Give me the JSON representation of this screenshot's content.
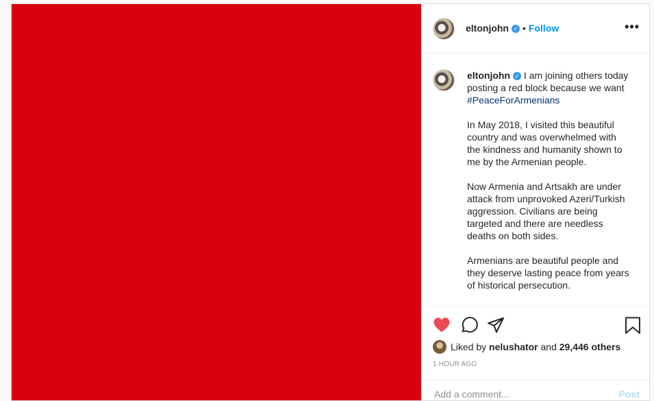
{
  "colors": {
    "media_fill": "#d9000f",
    "like_active": "#ed4956",
    "link_blue": "#0095f6",
    "hashtag": "#00376b"
  },
  "header": {
    "username": "eltonjohn",
    "separator": "•",
    "follow_label": "Follow",
    "more_label": "•••"
  },
  "caption": {
    "username": "eltonjohn",
    "first_text": "I am joining others today posting a red block because we want",
    "hashtag": "#PeaceForArmenians",
    "paragraphs": [
      "In May 2018, I visited this beautiful country and was overwhelmed with the kindness and humanity shown to me by the Armenian people.",
      "Now Armenia and Artsakh are under attack from unprovoked Azeri/Turkish aggression. Civilians are being targeted and there are needless deaths on both sides.",
      "Armenians are beautiful people and they deserve lasting peace from years of historical persecution."
    ]
  },
  "actions": {
    "icons": [
      "heart-icon",
      "comment-icon",
      "share-icon",
      "bookmark-icon"
    ],
    "liked": true,
    "likes_prefix": "Liked by",
    "liked_by_user": "nelushator",
    "likes_joiner": "and",
    "others_count": "29,446 others",
    "timestamp": "1 HOUR AGO"
  },
  "comment_box": {
    "placeholder": "Add a comment...",
    "post_label": "Post"
  }
}
